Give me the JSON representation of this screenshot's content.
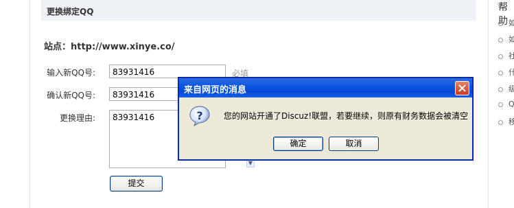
{
  "section": {
    "title": "更换绑定QQ"
  },
  "site": {
    "text": "站点：http://www.xinye.co/"
  },
  "form": {
    "new_qq_label": "输入新QQ号:",
    "new_qq_value": "83931416",
    "required_hint": "必填",
    "confirm_qq_label": "确认新QQ号:",
    "confirm_qq_value": "83931416",
    "reason_label": "更换理由:",
    "reason_value": "83931416",
    "submit_label": "提交"
  },
  "sidebar": {
    "title": "帮助",
    "items": [
      {
        "label": "如"
      },
      {
        "label": "如"
      },
      {
        "label": "社"
      },
      {
        "label": "什"
      },
      {
        "label": "级"
      },
      {
        "label": "Q"
      },
      {
        "label": "移"
      }
    ]
  },
  "dialog": {
    "title": "来自网页的消息",
    "message": "您的网站开通了Discuz!联盟，若要继续，则原有财务数据会被清空",
    "ok_label": "确定",
    "cancel_label": "取消",
    "icon": "question-icon"
  },
  "colors": {
    "titlebar": "#0a55e0",
    "dialog_bg": "#ece9d8",
    "header_bg": "#eef1f5"
  }
}
